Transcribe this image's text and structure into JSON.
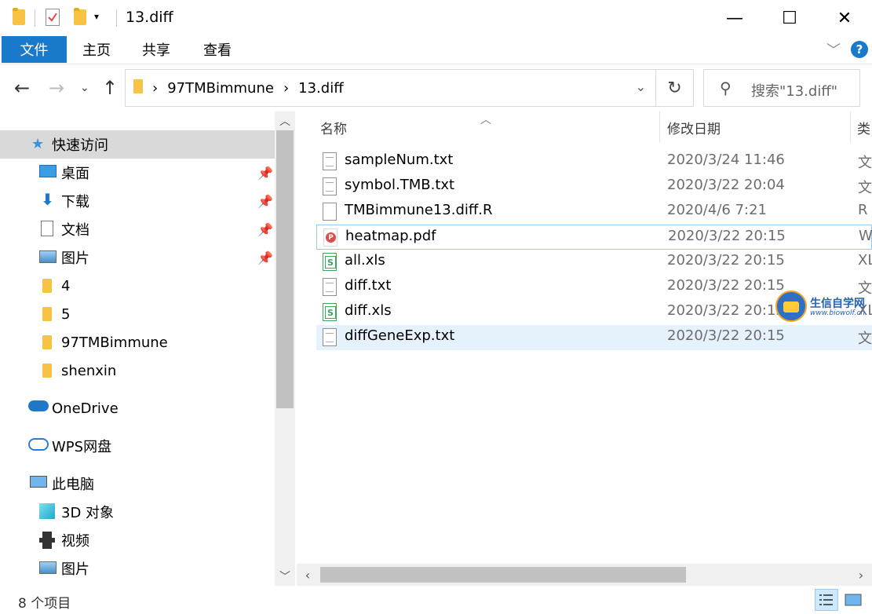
{
  "window": {
    "title": "13.diff",
    "minimize": "—",
    "maximize": "☐",
    "close": "✕"
  },
  "ribbon": {
    "tabs": [
      "文件",
      "主页",
      "共享",
      "查看"
    ],
    "help": "?"
  },
  "address": {
    "crumbs": [
      "97TMBimmune",
      "13.diff"
    ],
    "search_placeholder": "搜索\"13.diff\""
  },
  "nav": {
    "items": [
      {
        "label": "快速访问",
        "icon": "star-icon"
      },
      {
        "label": "桌面",
        "icon": "desktop-icon",
        "pinned": true
      },
      {
        "label": "下载",
        "icon": "download-icon",
        "pinned": true
      },
      {
        "label": "文档",
        "icon": "document-icon",
        "pinned": true
      },
      {
        "label": "图片",
        "icon": "picture-icon",
        "pinned": true
      },
      {
        "label": "4",
        "icon": "folder-icon"
      },
      {
        "label": "5",
        "icon": "folder-icon"
      },
      {
        "label": "97TMBimmune",
        "icon": "folder-icon"
      },
      {
        "label": "shenxin",
        "icon": "folder-icon"
      },
      {
        "label": "OneDrive",
        "icon": "cloud-icon"
      },
      {
        "label": "WPS网盘",
        "icon": "wps-cloud-icon"
      },
      {
        "label": "此电脑",
        "icon": "computer-icon"
      },
      {
        "label": "3D 对象",
        "icon": "cube-icon"
      },
      {
        "label": "视频",
        "icon": "video-icon"
      },
      {
        "label": "图片",
        "icon": "picture-icon"
      }
    ]
  },
  "columns": {
    "name": "名称",
    "date": "修改日期",
    "type": "类"
  },
  "files": [
    {
      "name": "sampleNum.txt",
      "date": "2020/3/24 11:46",
      "type": "文",
      "icon": "txt"
    },
    {
      "name": "symbol.TMB.txt",
      "date": "2020/3/22 20:04",
      "type": "文",
      "icon": "txt"
    },
    {
      "name": "TMBimmune13.diff.R",
      "date": "2020/4/6 7:21",
      "type": "R",
      "icon": "blank"
    },
    {
      "name": "heatmap.pdf",
      "date": "2020/3/22 20:15",
      "type": "W",
      "icon": "pdf"
    },
    {
      "name": "all.xls",
      "date": "2020/3/22 20:15",
      "type": "XL",
      "icon": "xls"
    },
    {
      "name": "diff.txt",
      "date": "2020/3/22 20:15",
      "type": "文",
      "icon": "txt"
    },
    {
      "name": "diff.xls",
      "date": "2020/3/22 20:15",
      "type": "XL",
      "icon": "xls"
    },
    {
      "name": "diffGeneExp.txt",
      "date": "2020/3/22 20:15",
      "type": "文",
      "icon": "txt"
    }
  ],
  "status": {
    "count": "8 个项目"
  },
  "watermark": {
    "title": "生信自学网",
    "url": "www.biowolf.cn"
  },
  "colors": {
    "accent": "#1979ca",
    "selection": "#e5f1fb",
    "nav_selected": "#d9d9d9"
  }
}
